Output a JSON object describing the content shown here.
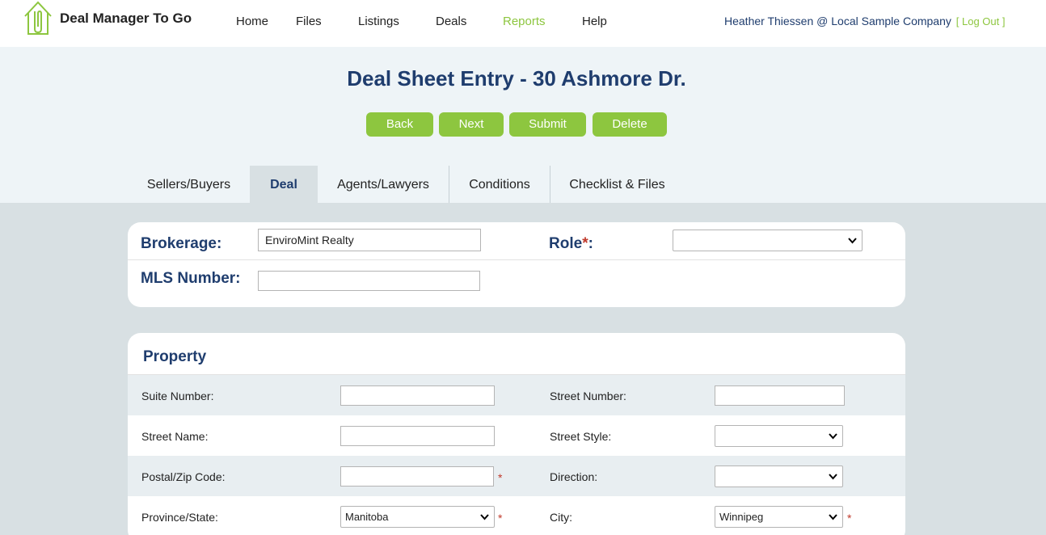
{
  "app": {
    "name": "Deal Manager To Go"
  },
  "nav": {
    "items": [
      {
        "label": "Home"
      },
      {
        "label": "Files"
      },
      {
        "label": "Listings"
      },
      {
        "label": "Deals"
      },
      {
        "label": "Reports",
        "active": true
      },
      {
        "label": "Help"
      }
    ]
  },
  "user": {
    "text": "Heather Thiessen @ Local Sample Company",
    "logout": "[ Log Out ]"
  },
  "page": {
    "title": "Deal Sheet Entry - 30 Ashmore Dr."
  },
  "actions": {
    "back": "Back",
    "next": "Next",
    "submit": "Submit",
    "delete": "Delete"
  },
  "tabs": [
    {
      "label": "Sellers/Buyers"
    },
    {
      "label": "Deal",
      "active": true
    },
    {
      "label": "Agents/Lawyers"
    },
    {
      "label": "Conditions"
    },
    {
      "label": "Checklist & Files"
    }
  ],
  "deal": {
    "brokerage_label": "Brokerage:",
    "brokerage_value": "EnviroMint Realty",
    "role_label": "Role",
    "role_required": "*",
    "role_colon": ":",
    "role_value": "",
    "mls_label": "MLS Number:",
    "mls_value": ""
  },
  "property": {
    "title": "Property",
    "suite_label": "Suite Number:",
    "street_number_label": "Street Number:",
    "street_name_label": "Street Name:",
    "street_style_label": "Street Style:",
    "postal_label": "Postal/Zip Code:",
    "direction_label": "Direction:",
    "province_label": "Province/State:",
    "province_value": "Manitoba",
    "city_label": "City:",
    "city_value": "Winnipeg",
    "required_mark": "*"
  },
  "colors": {
    "accent": "#8dc63f",
    "navy": "#1f3d6e",
    "required": "#c0392b"
  },
  "icons": {
    "logo": "house-paperclip-icon",
    "select_caret": "chevron-down-icon"
  }
}
